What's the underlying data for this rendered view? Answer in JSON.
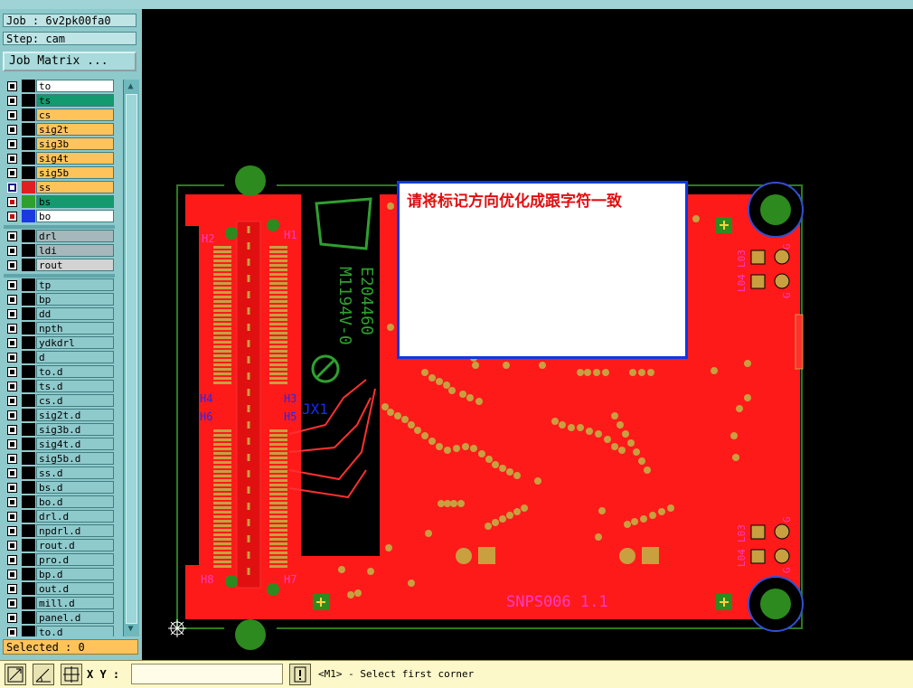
{
  "job_label": "Job : 6v2pk00fa0",
  "step_label": "Step: cam",
  "job_matrix_button": "Job Matrix ...",
  "layers_board": [
    {
      "name": "to",
      "color": "#ffffff"
    },
    {
      "name": "ts",
      "color": "#139a6e"
    },
    {
      "name": "cs",
      "color": "#ffc35c"
    },
    {
      "name": "sig2t",
      "color": "#ffc35c"
    },
    {
      "name": "sig3b",
      "color": "#ffc35c"
    },
    {
      "name": "sig4t",
      "color": "#ffc35c"
    },
    {
      "name": "sig5b",
      "color": "#ffc35c"
    },
    {
      "name": "ss",
      "color": "#ffc35c"
    },
    {
      "name": "bs",
      "color": "#139a6e"
    },
    {
      "name": "bo",
      "color": "#ffffff"
    }
  ],
  "layers_drill": [
    {
      "name": "drl",
      "color": "#a6b8bb"
    },
    {
      "name": "ldi",
      "color": "#a6b8bb"
    },
    {
      "name": "rout",
      "color": "#d3d3d3"
    }
  ],
  "layers_misc": [
    "tp",
    "bp",
    "dd",
    "npth",
    "ydkdrl",
    "d",
    "to.d",
    "ts.d",
    "cs.d",
    "sig2t.d",
    "sig3b.d",
    "sig4t.d",
    "sig5b.d",
    "ss.d",
    "bs.d",
    "bo.d",
    "drl.d",
    "npdrl.d",
    "rout.d",
    "pro.d",
    "bp.d",
    "out.d",
    "mill.d",
    "panel.d",
    "to.d"
  ],
  "selected_label": "Selected : 0",
  "xy_label": "X Y :",
  "prompt_text": "<M1> - Select first corner",
  "pcb": {
    "silk_part": "E204460",
    "silk_model": "M1194V-0",
    "silk_jx": "JX1",
    "silk_name": "SNPS006  1.1",
    "holes": [
      "H1",
      "H2",
      "H3",
      "H4",
      "H5",
      "H6",
      "H7",
      "H8"
    ],
    "lbl_l03": "L03",
    "lbl_l04": "L04",
    "lbl_g": "G"
  },
  "message": "请将标记方向优化成跟字符一致",
  "colors": {
    "panel": "#8ec9cc",
    "accent": "#ffc35c",
    "copper": "#ff1a1a",
    "board_outline": "#2d7a1e",
    "silk": "#2fa02f",
    "message_border": "#1038e0",
    "message_text": "#e01010"
  }
}
